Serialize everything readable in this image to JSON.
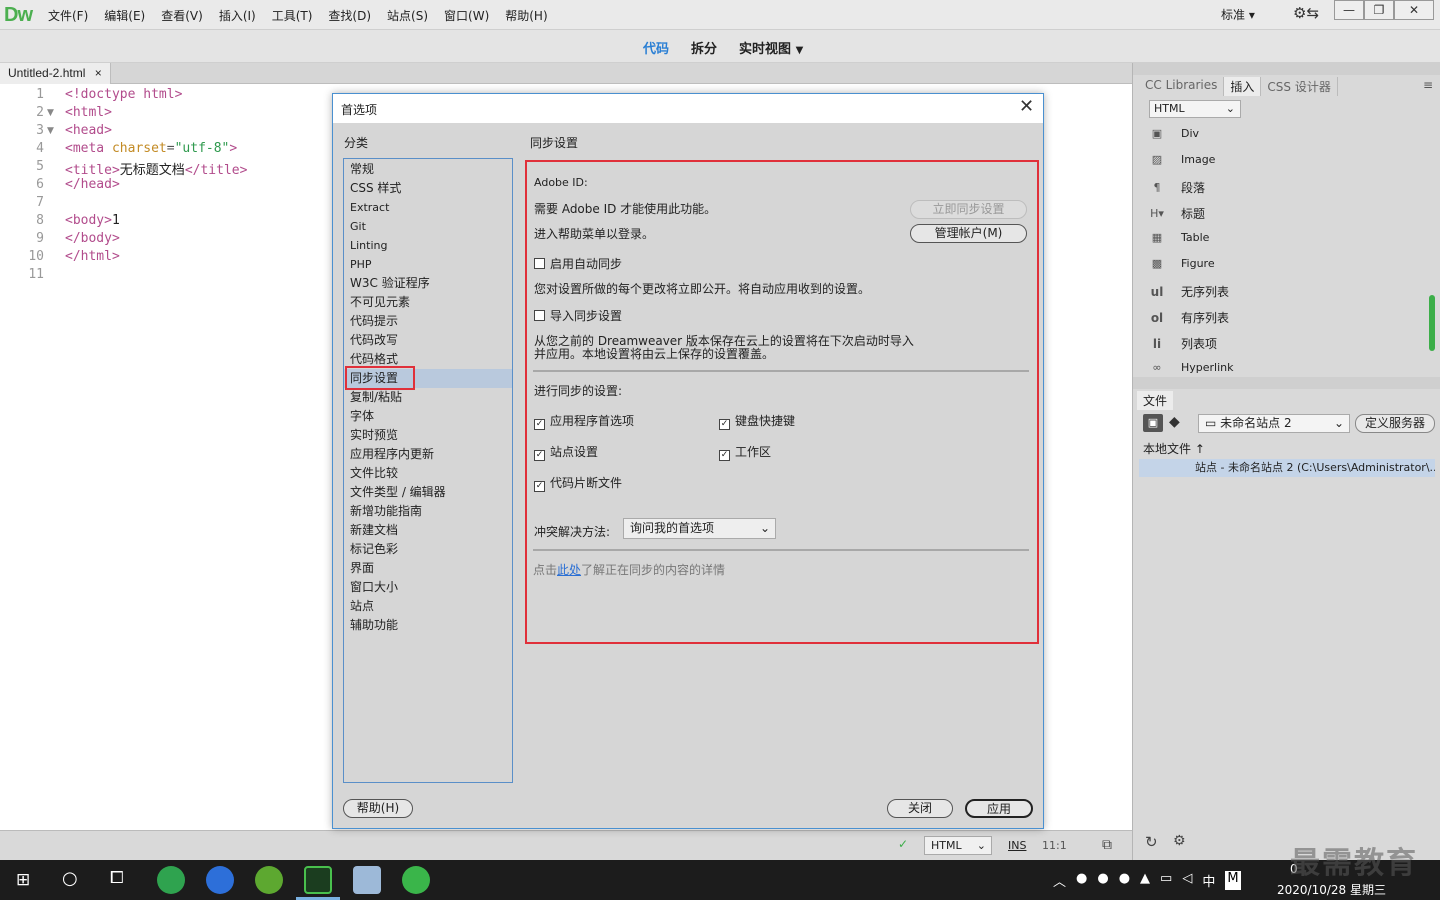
{
  "app": {
    "logo": "Dw"
  },
  "menu": [
    "文件(F)",
    "编辑(E)",
    "查看(V)",
    "插入(I)",
    "工具(T)",
    "查找(D)",
    "站点(S)",
    "窗口(W)",
    "帮助(H)"
  ],
  "workspace": {
    "label": "标准",
    "minimize": "—",
    "restore": "❐",
    "close": "✕"
  },
  "toolbar": {
    "code": "代码",
    "split": "拆分",
    "live": "实时视图"
  },
  "doc_tab": {
    "name": "Untitled-2.html",
    "close": "×"
  },
  "editor": {
    "line_numbers": [
      "1",
      "2",
      "3",
      "4",
      "5",
      "6",
      "7",
      "8",
      "9",
      "10",
      "11"
    ],
    "lines": {
      "l1": "<!doctype html>",
      "l2": "<html>",
      "l3": "<head>",
      "l4_open": "<meta ",
      "l4_attr": "charset",
      "l4_eq": "=",
      "l4_val": "\"utf-8\"",
      "l4_close": ">",
      "l5_open": "<title>",
      "l5_text": "无标题文档",
      "l5_close": "</title>",
      "l6": "</head>",
      "l8_open": "<body>",
      "l8_text": "1",
      "l9": "</body>",
      "l10": "</html>"
    }
  },
  "right_panel": {
    "tabs": [
      "CC Libraries",
      "插入",
      "CSS 设计器"
    ],
    "insert_category": "HTML",
    "insert_items": [
      {
        "icon": "div-icon",
        "label": "Div"
      },
      {
        "icon": "image-icon",
        "label": "Image"
      },
      {
        "icon": "paragraph-icon",
        "label": "段落"
      },
      {
        "icon": "heading-icon",
        "label": "标题"
      },
      {
        "icon": "table-icon",
        "label": "Table"
      },
      {
        "icon": "figure-icon",
        "label": "Figure"
      },
      {
        "icon": "ul",
        "label": "无序列表"
      },
      {
        "icon": "ol",
        "label": "有序列表"
      },
      {
        "icon": "li",
        "label": "列表项"
      },
      {
        "icon": "hyperlink-icon",
        "label": "Hyperlink"
      }
    ],
    "files_tab": "文件",
    "site_select": "未命名站点 2",
    "define_server": "定义服务器",
    "local_files": "本地文件 ↑",
    "site_row": "站点 - 未命名站点 2 (C:\\Users\\Administrator\\..."
  },
  "statusbar": {
    "doc_type": "HTML",
    "ins": "INS",
    "pos": "11:1"
  },
  "dialog": {
    "title": "首选项",
    "close": "✕",
    "category_label": "分类",
    "categories": [
      "常规",
      "CSS 样式",
      "Extract",
      "Git",
      "Linting",
      "PHP",
      "W3C 验证程序",
      "不可见元素",
      "代码提示",
      "代码改写",
      "代码格式",
      "同步设置",
      "复制/粘贴",
      "字体",
      "实时预览",
      "应用程序内更新",
      "文件比较",
      "文件类型 / 编辑器",
      "新增功能指南",
      "新建文档",
      "标记色彩",
      "界面",
      "窗口大小",
      "站点",
      "辅助功能"
    ],
    "selected_category": "同步设置",
    "section_title": "同步设置",
    "adobe_id_label": "Adobe ID:",
    "need_id": "需要 Adobe ID 才能使用此功能。",
    "login_hint": "进入帮助菜单以登录。",
    "sync_now": "立即同步设置",
    "manage_account": "管理帐户(M)",
    "auto_sync": "启用自动同步",
    "auto_sync_desc": "您对设置所做的每个更改将立即公开。将自动应用收到的设置。",
    "import_sync": "导入同步设置",
    "import_desc_1": "从您之前的 Dreamweaver 版本保存在云上的设置将在下次启动时导入",
    "import_desc_2": "并应用。本地设置将由云上保存的设置覆盖。",
    "sync_items_label": "进行同步的设置:",
    "opt_app_prefs": "应用程序首选项",
    "opt_keyboard": "键盘快捷键",
    "opt_site": "站点设置",
    "opt_workspace": "工作区",
    "opt_snippets": "代码片断文件",
    "conflict_label": "冲突解决方法:",
    "conflict_value": "询问我的首选项",
    "link_prefix": "点击",
    "link_text": "此处",
    "link_suffix": "了解正在同步的内容的详情",
    "help": "帮助(H)",
    "close_btn": "关闭",
    "apply": "应用"
  },
  "taskbar": {
    "time": "0",
    "date": "2020/10/28 星期三",
    "ime": "中",
    "ime2": "M"
  },
  "watermark": "最需教育",
  "colors": {
    "accent": "#2a7fd4",
    "highlight_box": "#e0303a",
    "selection": "#b9c9dd"
  }
}
